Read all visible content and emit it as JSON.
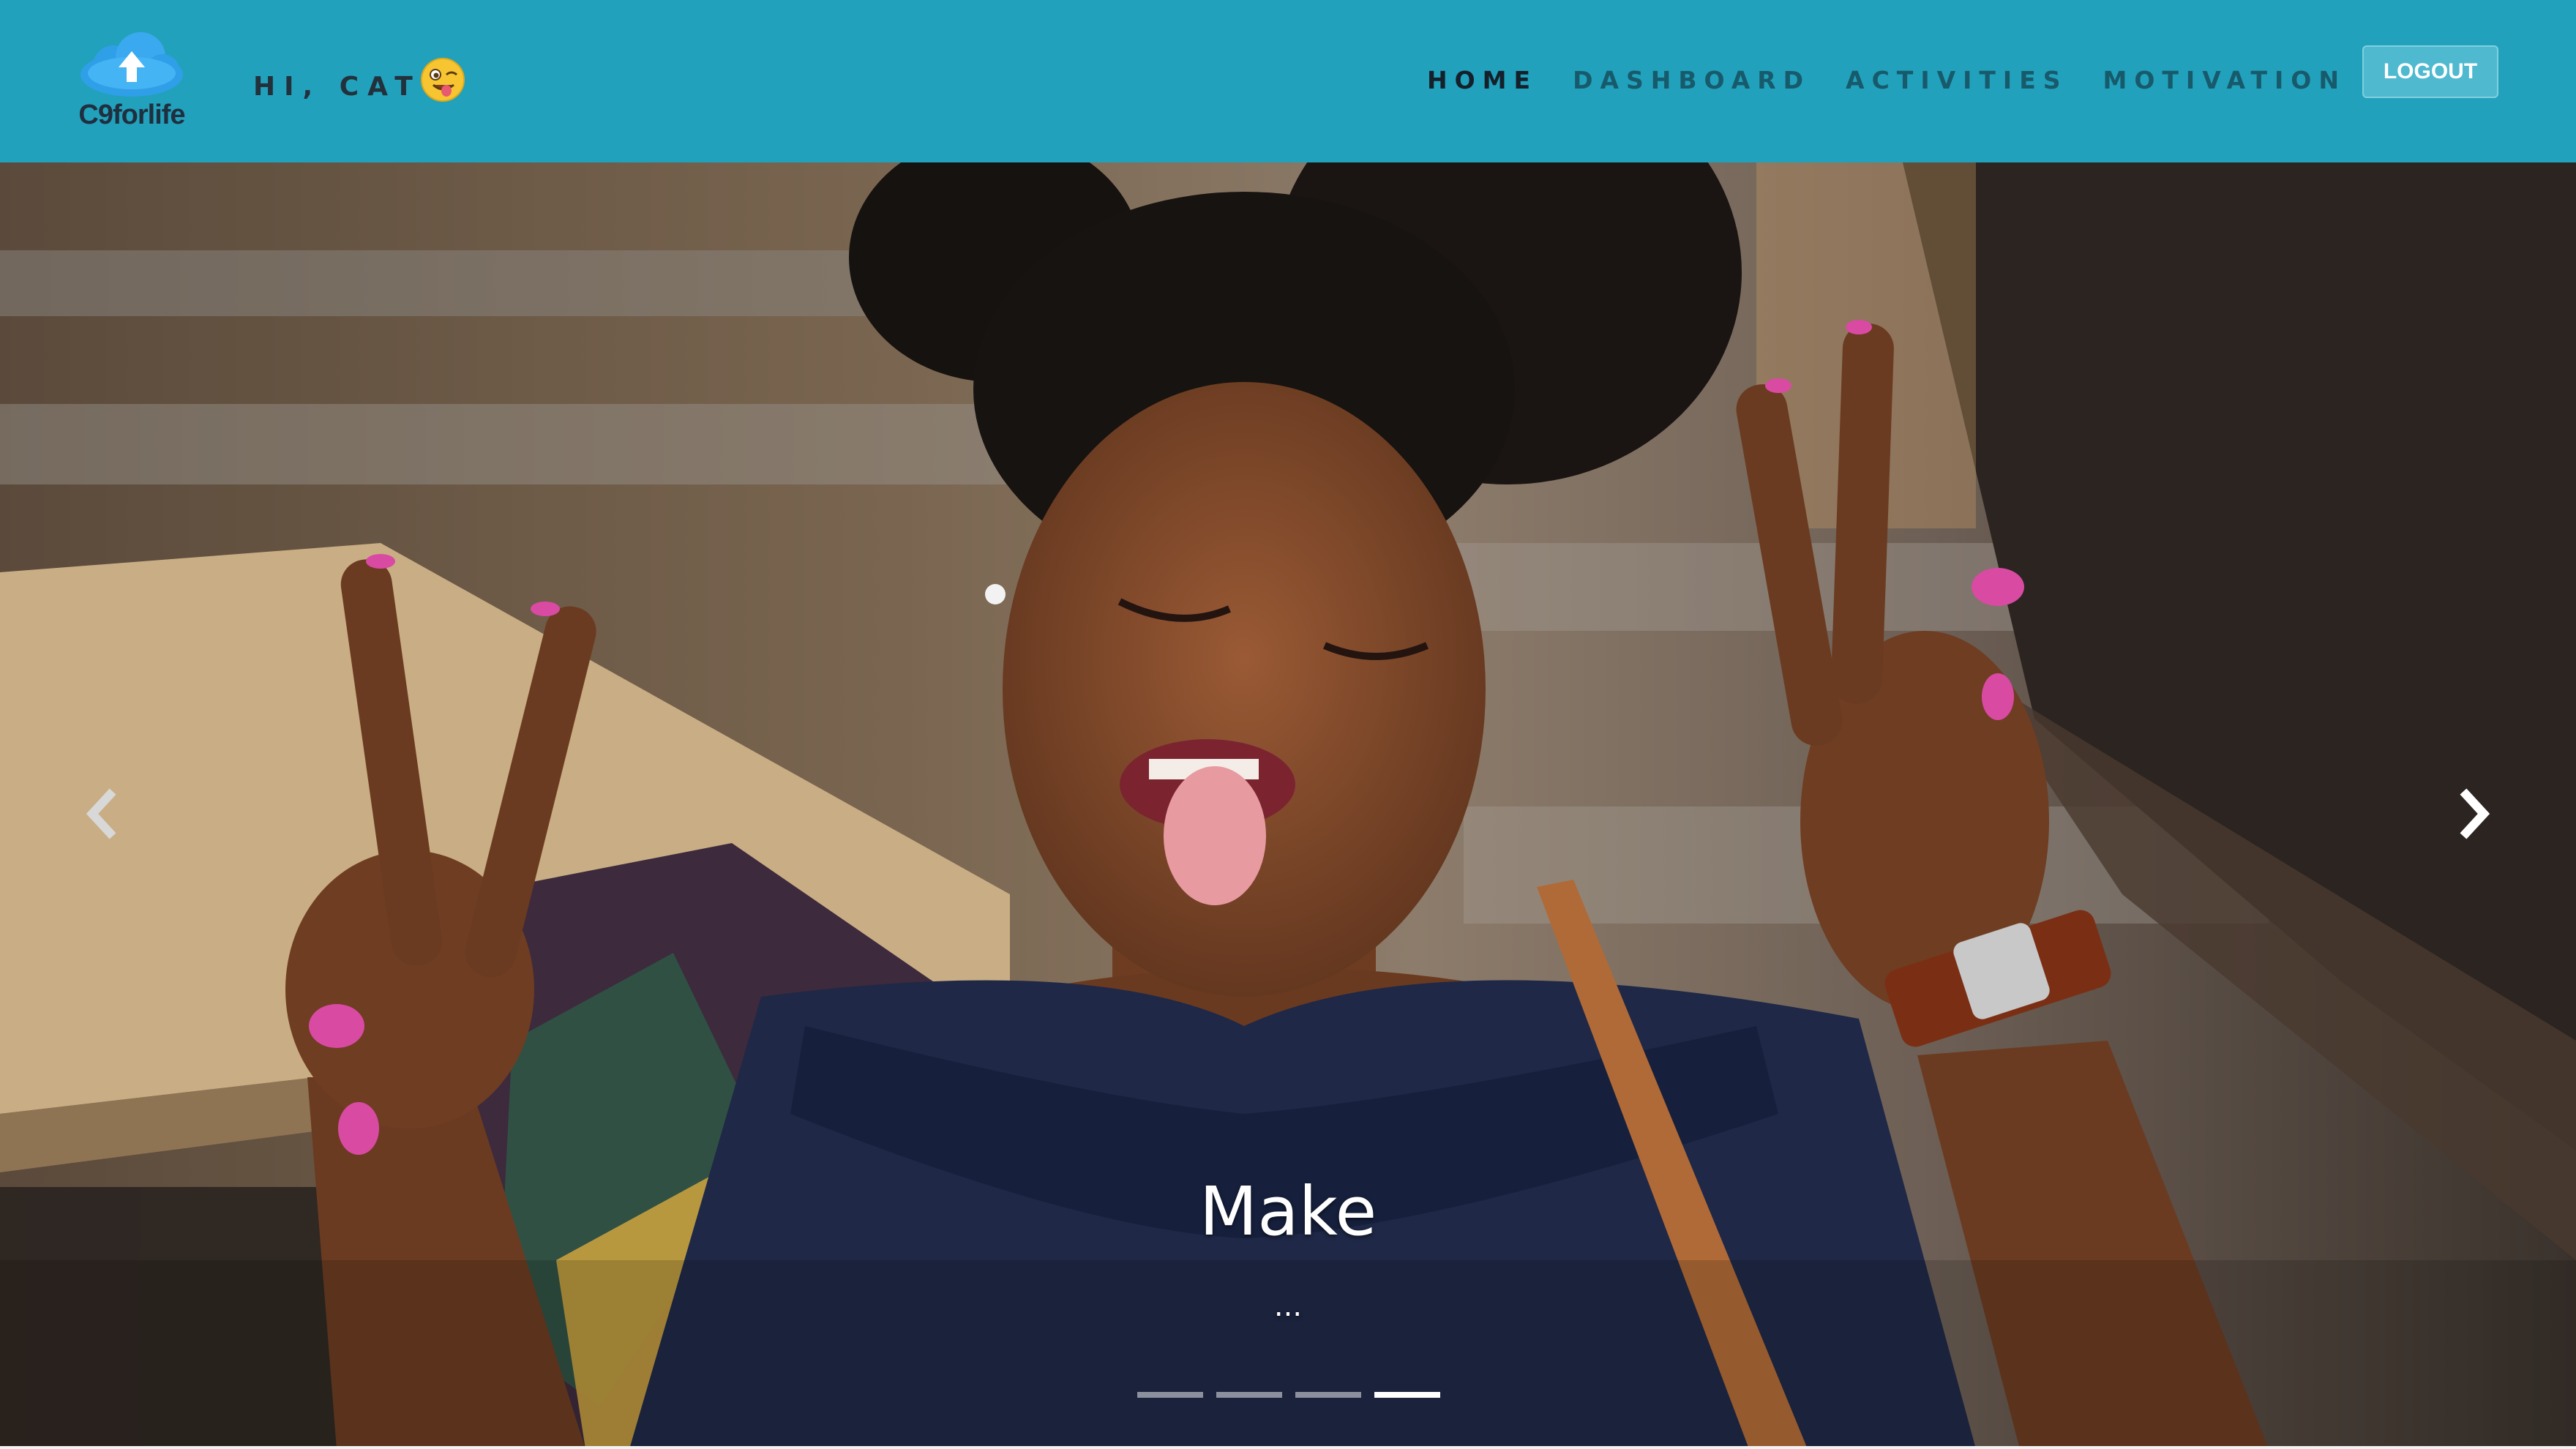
{
  "brand": {
    "logo_text": "C9forlife",
    "logo_icon": "cloud-upload-icon",
    "cloud_color": "#2f9fe8"
  },
  "greeting": {
    "text": "HI, CAT",
    "emoji": "winking-tongue-emoji"
  },
  "nav": {
    "items": [
      {
        "label": "HOME",
        "active": true
      },
      {
        "label": "DASHBOARD",
        "active": false
      },
      {
        "label": "ACTIVITIES",
        "active": false
      },
      {
        "label": "MOTIVATION",
        "active": false
      }
    ],
    "logout_label": "LOGOUT"
  },
  "carousel": {
    "caption_title": "Make",
    "caption_sub": "...",
    "prev_icon": "chevron-left-icon",
    "next_icon": "chevron-right-icon",
    "slide_count": 4,
    "active_index": 3
  },
  "colors": {
    "navbar": "#22a1bc",
    "logout_button": "#4fb9cf"
  }
}
